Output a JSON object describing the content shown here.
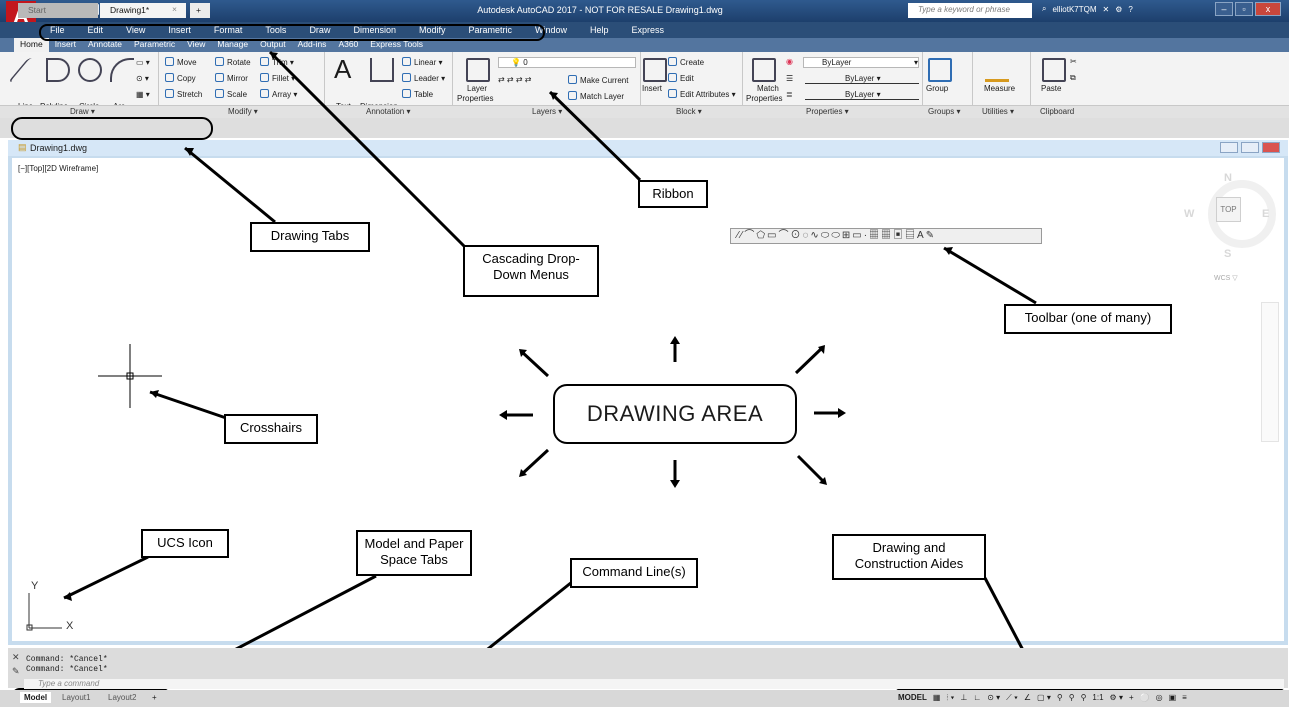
{
  "window": {
    "title": "Autodesk AutoCAD 2017 - NOT FOR RESALE   Drawing1.dwg",
    "app_button": "A",
    "search_placeholder": "Type a keyword or phrase",
    "user": "elliotK7TQM"
  },
  "menubar": {
    "items": [
      "File",
      "Edit",
      "View",
      "Insert",
      "Format",
      "Tools",
      "Draw",
      "Dimension",
      "Modify",
      "Parametric",
      "Window",
      "Help",
      "Express"
    ]
  },
  "ribbon_tabs": [
    "Home",
    "Insert",
    "Annotate",
    "Parametric",
    "View",
    "Manage",
    "Output",
    "Add-ins",
    "A360",
    "Express Tools"
  ],
  "ribbon": {
    "draw": {
      "label": "Draw ▾",
      "line": "Line",
      "polyline": "Polyline",
      "circle": "Circle",
      "arc": "Arc"
    },
    "modify": {
      "label": "Modify ▾",
      "move": "Move",
      "rotate": "Rotate",
      "trim": "Trim",
      "copy": "Copy",
      "mirror": "Mirror",
      "fillet": "Fillet",
      "stretch": "Stretch",
      "scale": "Scale",
      "array": "Array"
    },
    "annotation": {
      "label": "Annotation ▾",
      "text": "Text",
      "dimension": "Dimension",
      "linear": "Linear",
      "leader": "Leader",
      "table": "Table"
    },
    "layers": {
      "label": "Layers ▾",
      "layer_properties_1": "Layer",
      "layer_properties_2": "Properties",
      "current_layer": "0",
      "make_current": "Make Current",
      "match_layer": "Match Layer"
    },
    "block": {
      "label": "Block ▾",
      "insert": "Insert",
      "create": "Create",
      "edit": "Edit",
      "edit_attributes": "Edit Attributes"
    },
    "properties": {
      "label": "Properties ▾",
      "match_1": "Match",
      "match_2": "Properties",
      "color": "ByLayer",
      "linetype": "ByLayer",
      "lineweight": "ByLayer"
    },
    "groups": {
      "label": "Groups ▾",
      "group": "Group"
    },
    "utilities": {
      "label": "Utilities ▾",
      "measure": "Measure"
    },
    "clipboard": {
      "label": "Clipboard",
      "paste": "Paste"
    }
  },
  "file_tabs": {
    "start": "Start",
    "active": "Drawing1*",
    "close": "×",
    "add": "+"
  },
  "viewport": {
    "title": "Drawing1.dwg",
    "label": "[−][Top][2D Wireframe]",
    "viewcube": {
      "top": "TOP",
      "n": "N",
      "s": "S",
      "e": "E",
      "w": "W",
      "wcs": "WCS ▽"
    }
  },
  "ucs": {
    "y": "Y",
    "x": "X"
  },
  "command": {
    "lines": [
      "Command: *Cancel*",
      "Command: *Cancel*"
    ],
    "placeholder": "Type a command"
  },
  "layout_tabs": [
    "Model",
    "Layout1",
    "Layout2",
    "+"
  ],
  "status": {
    "model": "MODEL",
    "scale": "1:1"
  },
  "annotations": {
    "drawing_tabs": "Drawing Tabs",
    "cascading_1": "Cascading Drop-",
    "cascading_2": "Down Menus",
    "ribbon": "Ribbon",
    "toolbar": "Toolbar (one of many)",
    "crosshairs": "Crosshairs",
    "drawing_area": "DRAWING AREA",
    "ucs_icon": "UCS Icon",
    "model_paper_1": "Model and Paper",
    "model_paper_2": "Space Tabs",
    "command_line": "Command Line(s)",
    "aides_1": "Drawing and",
    "aides_2": "Construction Aides"
  }
}
